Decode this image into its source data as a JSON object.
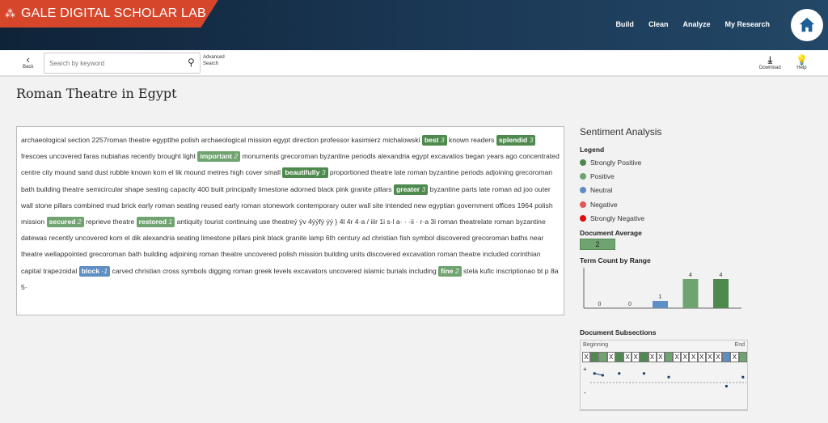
{
  "header": {
    "brand": "GALE DIGITAL SCHOLAR LAB",
    "nav": [
      "Build",
      "Clean",
      "Analyze",
      "My Research"
    ],
    "home_icon": "home-icon"
  },
  "toolbar": {
    "back": "Back",
    "search_placeholder": "Search by keyword",
    "advanced": "Advanced Search",
    "download": "Download",
    "help": "Help"
  },
  "page_title": "Roman Theatre in Egypt",
  "document": [
    {
      "text": "archaeological section 2257roman theatre egyptthe polish archaeological mission egypt direction professor kasimierz michalowski "
    },
    {
      "term": "best",
      "score": "3",
      "cls": "sp"
    },
    {
      "text": " known readers "
    },
    {
      "term": "splendid",
      "score": "3",
      "cls": "sp"
    },
    {
      "text": " frescoes uncovered faras nubiahas recently brought light "
    },
    {
      "term": "important",
      "score": "2",
      "cls": "p"
    },
    {
      "text": " monurnents grecoroman byzantine periodls alexandria egypt excavatios began years ago concentrated centre city mound sand dust rubble known kom el lik mound metres high cover small "
    },
    {
      "term": "beautifully",
      "score": "3",
      "cls": "sp"
    },
    {
      "text": " proportioned theatre late roman byzantine periods adjoining grecoroman bath building theatre semicircular shape seating capacity 400 built principally limestone adorned black pink granite pillars "
    },
    {
      "term": "greater",
      "score": "3",
      "cls": "sp"
    },
    {
      "text": " byzantine parts late roman ad joo outer wall stone pillars combined mud brick early roman seating reused early roman stonework contemporary outer wall site intended new egyptian government offices 1964 polish mission "
    },
    {
      "term": "secured",
      "score": "2",
      "cls": "p"
    },
    {
      "text": " reprieve theatre "
    },
    {
      "term": "restored",
      "score": "1",
      "cls": "p"
    },
    {
      "text": " antiquity tourist continuing use theatreý ýv 4ýýfý ýý } 4l 4r 4·a / iiir 1i s·l a· · ·ii · r·a 3i roman theatrelate roman byzantine datewas recently uncovered kom el dik alexandria seating limestone pillars pink black granite lamp 6th century ad christian fish symbol discovered grecoroman baths near theatre wellappointed grecoroman bath building adjoining roman theatre uncovered polish mission building units discovered excavation roman theatre included corinthian capital trapezoidal "
    },
    {
      "term": "block",
      "score": "-1",
      "cls": "n"
    },
    {
      "text": " carved christian cross symbols digging roman greek levels excavators uncovered islamic burials including "
    },
    {
      "term": "fine",
      "score": "2",
      "cls": "p"
    },
    {
      "text": " stela kufic inscriptionao bt p 8a 5·"
    }
  ],
  "sentiment": {
    "title": "Sentiment Analysis",
    "legend_title": "Legend",
    "legend": [
      {
        "label": "Strongly Positive",
        "color": "#4e8a4e"
      },
      {
        "label": "Positive",
        "color": "#6fa36f"
      },
      {
        "label": "Neutral",
        "color": "#5d8ec4"
      },
      {
        "label": "Negative",
        "color": "#e05a5a"
      },
      {
        "label": "Strongly Negative",
        "color": "#e01010"
      }
    ],
    "average_title": "Document Average",
    "average": "2",
    "term_count_title": "Term Count by Range",
    "subsections_title": "Document Subsections",
    "beginning": "Beginning",
    "end": "End",
    "plus": "+",
    "minus": "-",
    "subsections": [
      "X",
      "SP",
      "P",
      "X",
      "SP",
      "X",
      "X",
      "SP",
      "X",
      "X",
      "P",
      "X",
      "X",
      "X",
      "X",
      "X",
      "X",
      "N",
      "X",
      "P"
    ],
    "subsection_scores": [
      null,
      2.5,
      2,
      null,
      2.5,
      null,
      null,
      2.5,
      null,
      null,
      1.5,
      null,
      null,
      null,
      null,
      null,
      null,
      -1,
      null,
      1.5
    ]
  },
  "chart_data": {
    "type": "bar",
    "categories": [
      "Strongly Negative",
      "Negative",
      "Neutral",
      "Positive",
      "Strongly Positive"
    ],
    "values": [
      0,
      0,
      1,
      4,
      4
    ],
    "colors": [
      "#e01010",
      "#e05a5a",
      "#5d8ec4",
      "#6fa36f",
      "#4e8a4e"
    ],
    "ylim": [
      0,
      4
    ]
  }
}
